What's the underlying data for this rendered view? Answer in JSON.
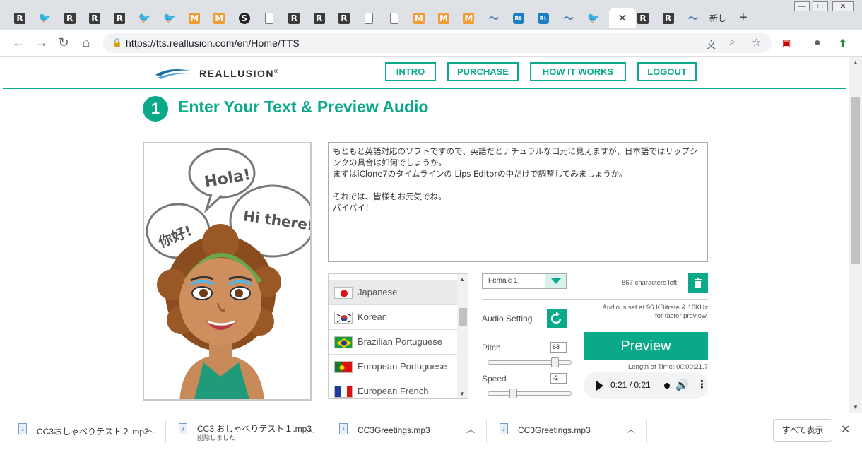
{
  "browser": {
    "tabs": [
      {
        "name": "tab-reallusion-1",
        "fav": "r",
        "glyph": "R"
      },
      {
        "name": "tab-bird-1",
        "fav": "bird",
        "glyph": "🐦"
      },
      {
        "name": "tab-reallusion-2",
        "fav": "r",
        "glyph": "R"
      },
      {
        "name": "tab-reallusion-3",
        "fav": "r",
        "glyph": "R"
      },
      {
        "name": "tab-reallusion-4",
        "fav": "r",
        "glyph": "R"
      },
      {
        "name": "tab-bird-2",
        "fav": "bird",
        "glyph": "🐦"
      },
      {
        "name": "tab-bird-3",
        "fav": "bird",
        "glyph": "🐦"
      },
      {
        "name": "tab-m-1",
        "fav": "m",
        "glyph": "M"
      },
      {
        "name": "tab-m-2",
        "fav": "m",
        "glyph": "M"
      },
      {
        "name": "tab-swirl",
        "fav": "swirl",
        "glyph": "S"
      },
      {
        "name": "tab-doc-1",
        "fav": "doc",
        "glyph": ""
      },
      {
        "name": "tab-reallusion-5",
        "fav": "r",
        "glyph": "R"
      },
      {
        "name": "tab-reallusion-6",
        "fav": "r",
        "glyph": "R"
      },
      {
        "name": "tab-reallusion-7",
        "fav": "r",
        "glyph": "R"
      },
      {
        "name": "tab-doc-2",
        "fav": "doc",
        "glyph": ""
      },
      {
        "name": "tab-doc-3",
        "fav": "doc",
        "glyph": ""
      },
      {
        "name": "tab-m-3",
        "fav": "m",
        "glyph": "M"
      },
      {
        "name": "tab-m-4",
        "fav": "m",
        "glyph": "M"
      },
      {
        "name": "tab-m-5",
        "fav": "m",
        "glyph": "M"
      },
      {
        "name": "tab-wave-1",
        "fav": "wave",
        "glyph": "〜"
      },
      {
        "name": "tab-rl-1",
        "fav": "rl",
        "glyph": "RL"
      },
      {
        "name": "tab-rl-2",
        "fav": "rl",
        "glyph": "RL"
      },
      {
        "name": "tab-wave-2",
        "fav": "wave",
        "glyph": "〜"
      },
      {
        "name": "tab-bird-4",
        "fav": "bird",
        "glyph": "🐦"
      }
    ],
    "tabs_after": [
      {
        "name": "tab-reallusion-8",
        "fav": "r",
        "glyph": "R"
      },
      {
        "name": "tab-reallusion-9",
        "fav": "r",
        "glyph": "R"
      },
      {
        "name": "tab-wave-3",
        "fav": "wave",
        "glyph": "〜"
      }
    ],
    "new_tab_title": "新し",
    "url": "https://tts.reallusion.com/en/Home/TTS",
    "icons": {
      "back": "arrow-left-icon",
      "forward": "arrow-right-icon",
      "reload": "reload-icon",
      "home": "home-icon",
      "lock": "lock-icon",
      "translate": "translate-icon",
      "zoom": "zoom-icon",
      "star": "star-icon",
      "extension": "extension-icon",
      "account": "account-icon",
      "update": "update-icon"
    }
  },
  "site": {
    "logo_text": "REALLUSION",
    "logo_mark": "®",
    "nav": [
      "INTRO",
      "PURCHASE",
      "HOW IT WORKS",
      "LOGOUT"
    ],
    "step_number": "1",
    "step_title": "Enter Your Text & Preview Audio",
    "bubbles": {
      "b1": "Hola!",
      "b2": "你好!",
      "b3": "Hi there!"
    }
  },
  "tts": {
    "text": "もともと英語対応のソフトですので、英語だとナチュラルな口元に見えますが、日本語ではリップシンクの具合は如何でしょうか。\nまずはiClone7のタイムラインの Lips Editorの中だけで調整してみましょうか。\n\nそれでは、皆様もお元気でね。\nバイバイ！",
    "languages": [
      {
        "label": "Japanese",
        "flag": "jp",
        "selected": true
      },
      {
        "label": "Korean",
        "flag": "kr",
        "selected": false
      },
      {
        "label": "Brazilian Portuguese",
        "flag": "br",
        "selected": false
      },
      {
        "label": "European Portuguese",
        "flag": "pt",
        "selected": false
      },
      {
        "label": "European French",
        "flag": "fr",
        "selected": false
      }
    ],
    "voice": "Female 1",
    "chars_left": "867 characters left.",
    "bitrate_note_1": "Audio is set at 96 KBitrate & 16KHz",
    "bitrate_note_2": "for faster preview.",
    "audio_setting_label": "Audio Setting",
    "pitch_label": "Pitch",
    "pitch_value": "68",
    "pitch_fraction": 0.82,
    "speed_label": "Speed",
    "speed_value": "-2",
    "speed_fraction": 0.28,
    "preview_label": "Preview",
    "length_time": "Length of Time: 00:00:21.7",
    "player_time": "0:21 / 0:21"
  },
  "downloads": {
    "items": [
      {
        "name": "CC3おしゃべりテスト２.mp3",
        "sub": ""
      },
      {
        "name": "CC3 おしゃべりテスト１.mp3",
        "sub": "削除しました"
      },
      {
        "name": "CC3Greetings.mp3",
        "sub": ""
      },
      {
        "name": "CC3Greetings.mp3",
        "sub": ""
      }
    ],
    "show_all": "すべて表示"
  },
  "colors": {
    "accent": "#0aa98a"
  }
}
